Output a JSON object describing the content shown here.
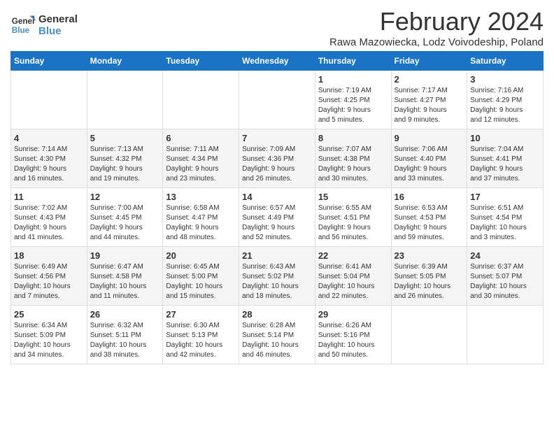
{
  "logo": {
    "line1": "General",
    "line2": "Blue"
  },
  "title": "February 2024",
  "subtitle": "Rawa Mazowiecka, Lodz Voivodeship, Poland",
  "headers": [
    "Sunday",
    "Monday",
    "Tuesday",
    "Wednesday",
    "Thursday",
    "Friday",
    "Saturday"
  ],
  "weeks": [
    [
      {
        "day": "",
        "info": ""
      },
      {
        "day": "",
        "info": ""
      },
      {
        "day": "",
        "info": ""
      },
      {
        "day": "",
        "info": ""
      },
      {
        "day": "1",
        "info": "Sunrise: 7:19 AM\nSunset: 4:25 PM\nDaylight: 9 hours\nand 5 minutes."
      },
      {
        "day": "2",
        "info": "Sunrise: 7:17 AM\nSunset: 4:27 PM\nDaylight: 9 hours\nand 9 minutes."
      },
      {
        "day": "3",
        "info": "Sunrise: 7:16 AM\nSunset: 4:29 PM\nDaylight: 9 hours\nand 12 minutes."
      }
    ],
    [
      {
        "day": "4",
        "info": "Sunrise: 7:14 AM\nSunset: 4:30 PM\nDaylight: 9 hours\nand 16 minutes."
      },
      {
        "day": "5",
        "info": "Sunrise: 7:13 AM\nSunset: 4:32 PM\nDaylight: 9 hours\nand 19 minutes."
      },
      {
        "day": "6",
        "info": "Sunrise: 7:11 AM\nSunset: 4:34 PM\nDaylight: 9 hours\nand 23 minutes."
      },
      {
        "day": "7",
        "info": "Sunrise: 7:09 AM\nSunset: 4:36 PM\nDaylight: 9 hours\nand 26 minutes."
      },
      {
        "day": "8",
        "info": "Sunrise: 7:07 AM\nSunset: 4:38 PM\nDaylight: 9 hours\nand 30 minutes."
      },
      {
        "day": "9",
        "info": "Sunrise: 7:06 AM\nSunset: 4:40 PM\nDaylight: 9 hours\nand 33 minutes."
      },
      {
        "day": "10",
        "info": "Sunrise: 7:04 AM\nSunset: 4:41 PM\nDaylight: 9 hours\nand 37 minutes."
      }
    ],
    [
      {
        "day": "11",
        "info": "Sunrise: 7:02 AM\nSunset: 4:43 PM\nDaylight: 9 hours\nand 41 minutes."
      },
      {
        "day": "12",
        "info": "Sunrise: 7:00 AM\nSunset: 4:45 PM\nDaylight: 9 hours\nand 44 minutes."
      },
      {
        "day": "13",
        "info": "Sunrise: 6:58 AM\nSunset: 4:47 PM\nDaylight: 9 hours\nand 48 minutes."
      },
      {
        "day": "14",
        "info": "Sunrise: 6:57 AM\nSunset: 4:49 PM\nDaylight: 9 hours\nand 52 minutes."
      },
      {
        "day": "15",
        "info": "Sunrise: 6:55 AM\nSunset: 4:51 PM\nDaylight: 9 hours\nand 56 minutes."
      },
      {
        "day": "16",
        "info": "Sunrise: 6:53 AM\nSunset: 4:53 PM\nDaylight: 9 hours\nand 59 minutes."
      },
      {
        "day": "17",
        "info": "Sunrise: 6:51 AM\nSunset: 4:54 PM\nDaylight: 10 hours\nand 3 minutes."
      }
    ],
    [
      {
        "day": "18",
        "info": "Sunrise: 6:49 AM\nSunset: 4:56 PM\nDaylight: 10 hours\nand 7 minutes."
      },
      {
        "day": "19",
        "info": "Sunrise: 6:47 AM\nSunset: 4:58 PM\nDaylight: 10 hours\nand 11 minutes."
      },
      {
        "day": "20",
        "info": "Sunrise: 6:45 AM\nSunset: 5:00 PM\nDaylight: 10 hours\nand 15 minutes."
      },
      {
        "day": "21",
        "info": "Sunrise: 6:43 AM\nSunset: 5:02 PM\nDaylight: 10 hours\nand 18 minutes."
      },
      {
        "day": "22",
        "info": "Sunrise: 6:41 AM\nSunset: 5:04 PM\nDaylight: 10 hours\nand 22 minutes."
      },
      {
        "day": "23",
        "info": "Sunrise: 6:39 AM\nSunset: 5:05 PM\nDaylight: 10 hours\nand 26 minutes."
      },
      {
        "day": "24",
        "info": "Sunrise: 6:37 AM\nSunset: 5:07 PM\nDaylight: 10 hours\nand 30 minutes."
      }
    ],
    [
      {
        "day": "25",
        "info": "Sunrise: 6:34 AM\nSunset: 5:09 PM\nDaylight: 10 hours\nand 34 minutes."
      },
      {
        "day": "26",
        "info": "Sunrise: 6:32 AM\nSunset: 5:11 PM\nDaylight: 10 hours\nand 38 minutes."
      },
      {
        "day": "27",
        "info": "Sunrise: 6:30 AM\nSunset: 5:13 PM\nDaylight: 10 hours\nand 42 minutes."
      },
      {
        "day": "28",
        "info": "Sunrise: 6:28 AM\nSunset: 5:14 PM\nDaylight: 10 hours\nand 46 minutes."
      },
      {
        "day": "29",
        "info": "Sunrise: 6:26 AM\nSunset: 5:16 PM\nDaylight: 10 hours\nand 50 minutes."
      },
      {
        "day": "",
        "info": ""
      },
      {
        "day": "",
        "info": ""
      }
    ]
  ]
}
